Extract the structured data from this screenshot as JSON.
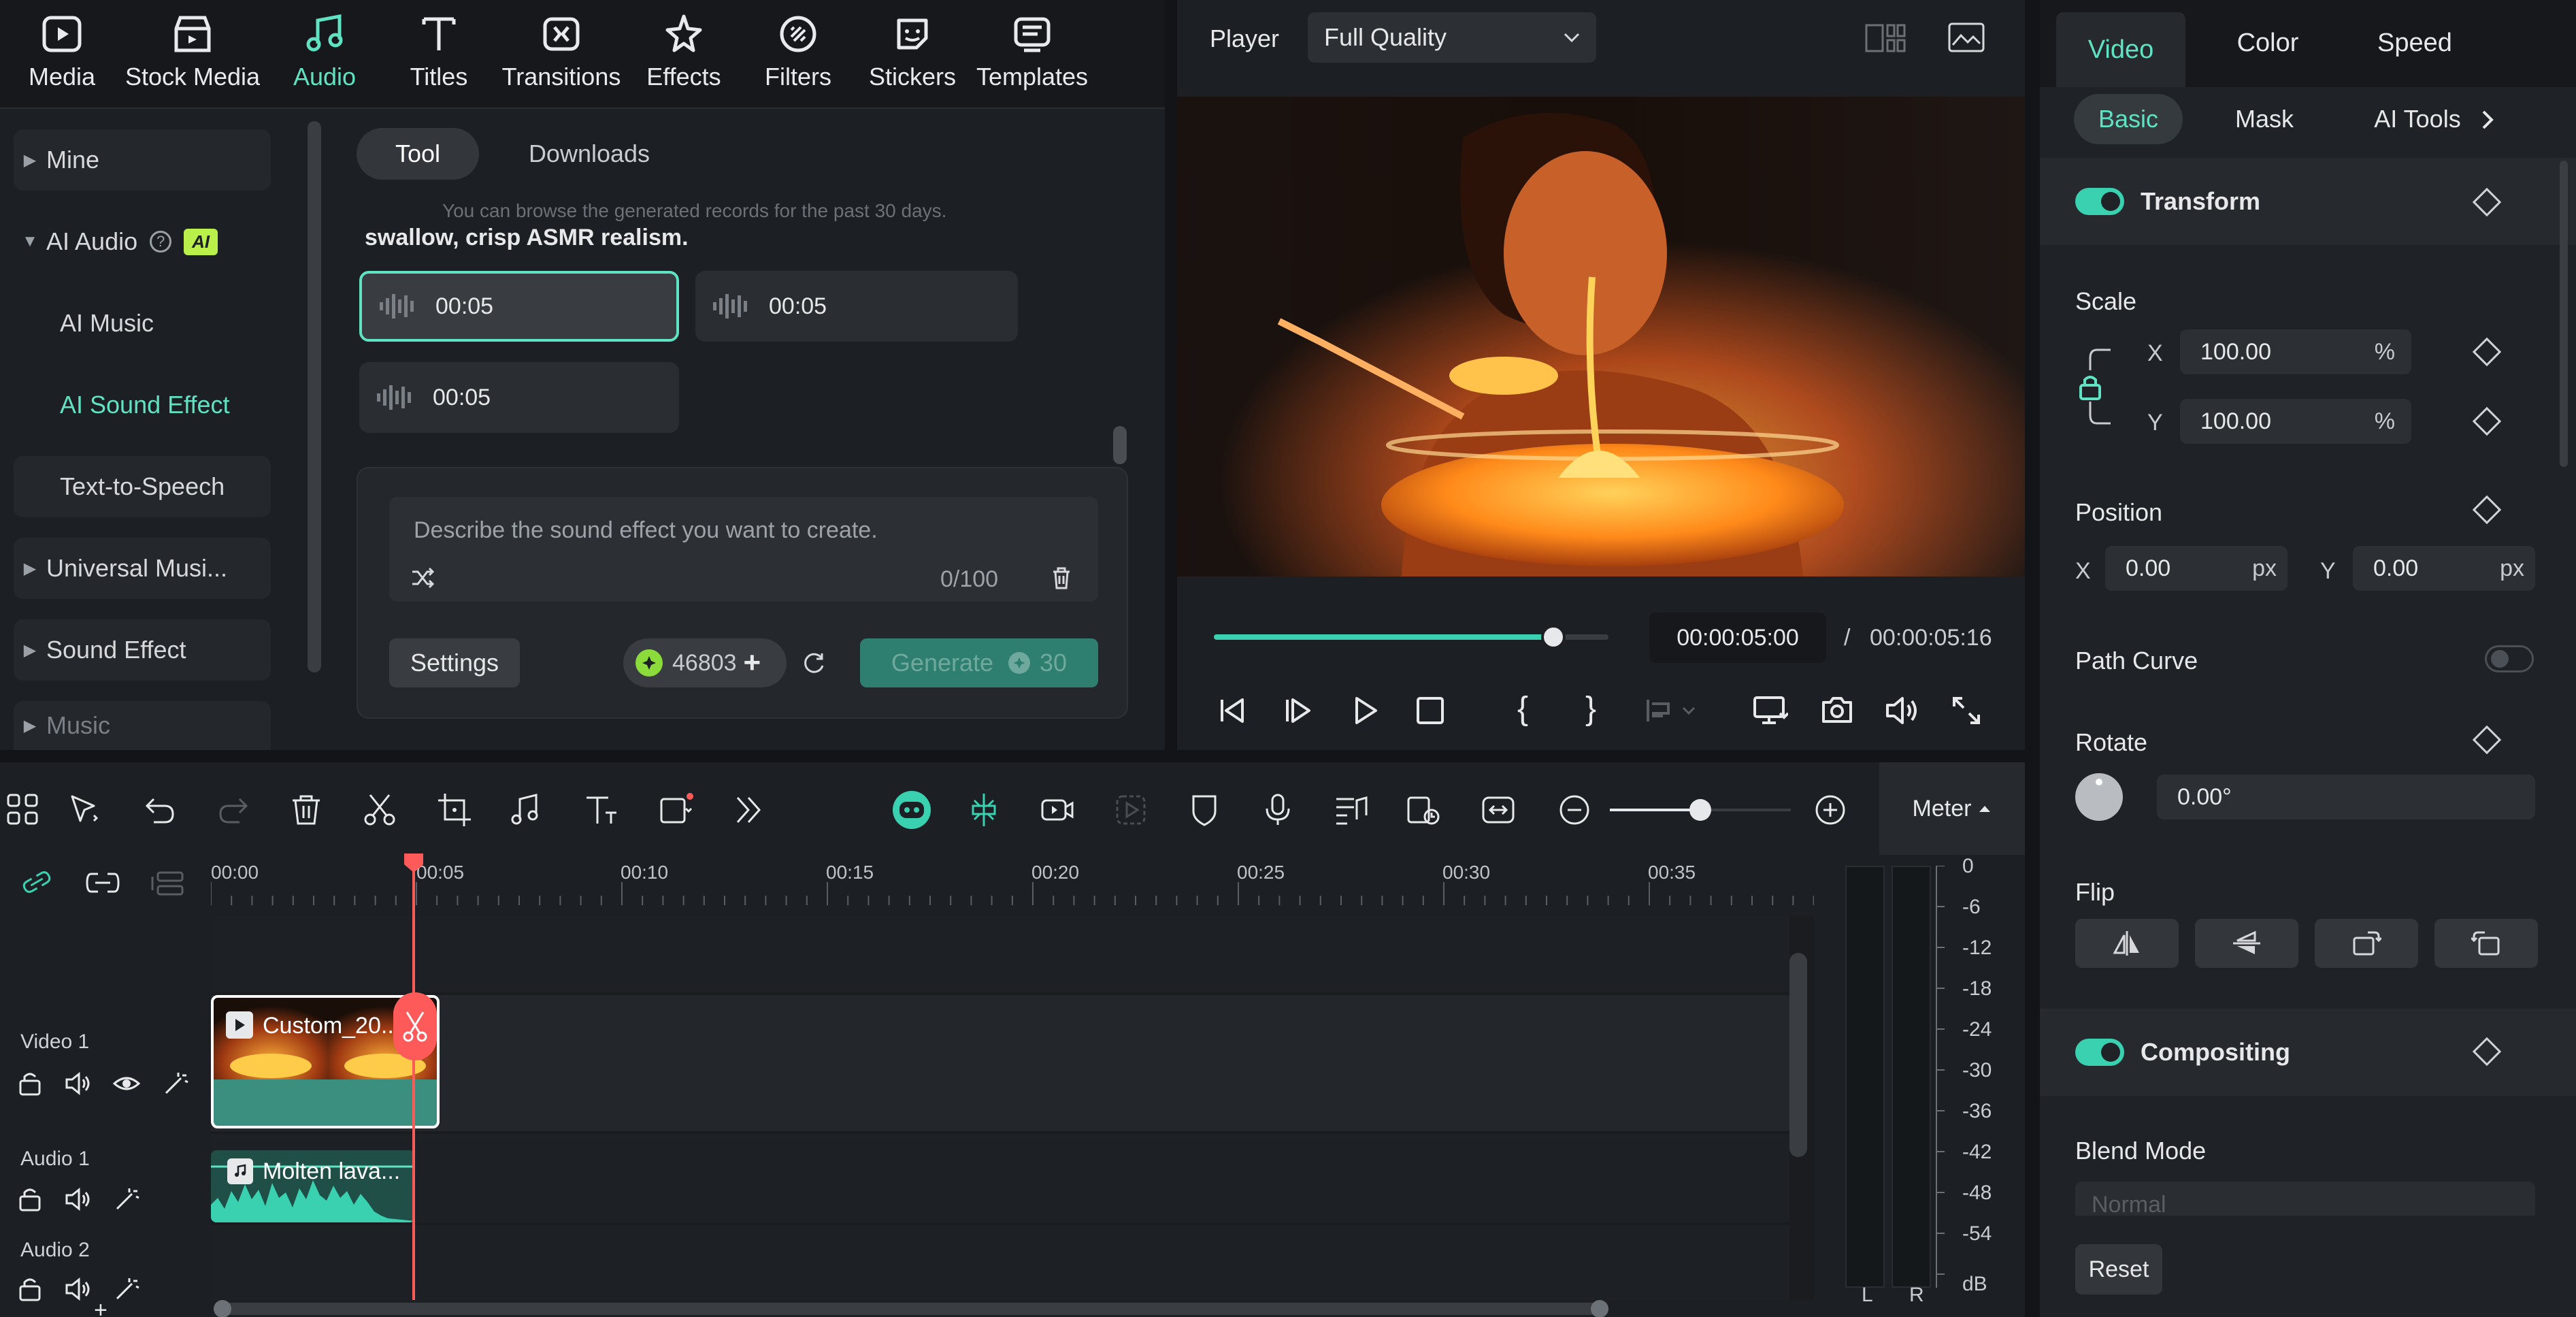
{
  "toolbar": {
    "items": [
      {
        "label": "Media",
        "icon": "media-icon"
      },
      {
        "label": "Stock Media",
        "icon": "stock-media-icon"
      },
      {
        "label": "Audio",
        "icon": "music-note-icon"
      },
      {
        "label": "Titles",
        "icon": "title-t-icon"
      },
      {
        "label": "Transitions",
        "icon": "transitions-icon"
      },
      {
        "label": "Effects",
        "icon": "effects-star-icon"
      },
      {
        "label": "Filters",
        "icon": "filters-icon"
      },
      {
        "label": "Stickers",
        "icon": "stickers-icon"
      },
      {
        "label": "Templates",
        "icon": "templates-icon"
      }
    ],
    "active": "Audio"
  },
  "categories": {
    "items": [
      "Mine",
      "AI Audio",
      "AI Music",
      "AI Sound Effect",
      "Text-to-Speech",
      "Universal Musi...",
      "Sound Effect",
      "Music"
    ],
    "ai_badge": "AI"
  },
  "toolpane": {
    "tabs": [
      "Tool",
      "Downloads"
    ],
    "notice": "You can browse the generated records for the past 30 days.",
    "prompt_tail": "swallow, crisp ASMR realism.",
    "results": [
      "00:05",
      "00:05",
      "00:05"
    ],
    "textarea_placeholder": "Describe the sound effect you want to create.",
    "char_count": "0/100",
    "settings_label": "Settings",
    "credits": "46803",
    "generate_label": "Generate",
    "generate_cost": "30"
  },
  "player": {
    "label": "Player",
    "quality": "Full Quality",
    "current_time": "00:00:05:00",
    "separator": "/",
    "total_time": "00:00:05:16",
    "progress_fraction": 0.86
  },
  "props": {
    "tabs": [
      "Video",
      "Color",
      "Speed"
    ],
    "subtabs": [
      "Basic",
      "Mask",
      "AI Tools"
    ],
    "transform": "Transform",
    "scale": "Scale",
    "scale_x": "100.00",
    "scale_y": "100.00",
    "pct": "%",
    "x": "X",
    "y": "Y",
    "position": "Position",
    "pos_x": "0.00",
    "pos_y": "0.00",
    "px": "px",
    "path_curve": "Path Curve",
    "rotate": "Rotate",
    "rotate_val": "0.00°",
    "flip": "Flip",
    "compositing": "Compositing",
    "blend_mode": "Blend Mode",
    "blend_value": "Normal",
    "reset": "Reset"
  },
  "timeline": {
    "meter_label": "Meter",
    "ruler": [
      "00:00",
      "00:05",
      "00:10",
      "00:15",
      "00:20",
      "00:25",
      "00:30",
      "00:35"
    ],
    "tracks": [
      "Video 1",
      "Audio 1",
      "Audio 2"
    ],
    "video_clip": "Custom_20...",
    "audio_clip": "Molten lava...",
    "db_ticks": [
      "0",
      "-6",
      "-12",
      "-18",
      "-24",
      "-30",
      "-36",
      "-42",
      "-48",
      "-54",
      "dB"
    ],
    "channels": [
      "L",
      "R"
    ],
    "zoom_fraction": 0.5
  },
  "colors": {
    "accent": "#3ad1b0",
    "playhead": "#ff5a5a",
    "panel": "#1c1f23"
  }
}
